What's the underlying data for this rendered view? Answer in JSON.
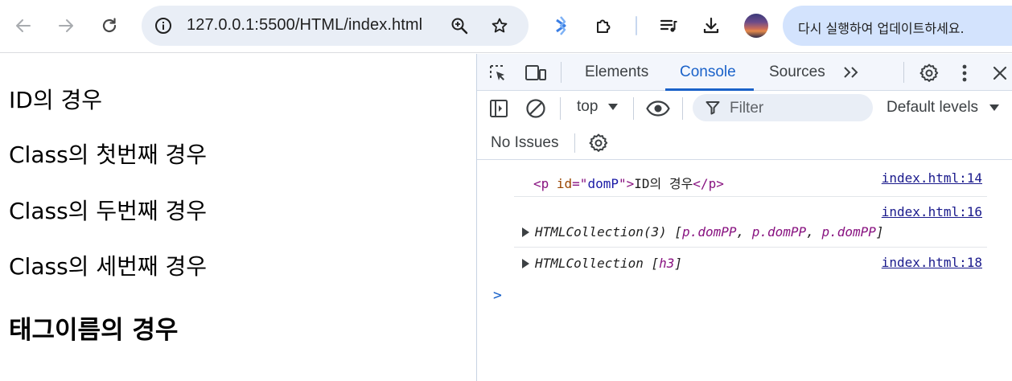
{
  "browser": {
    "url": "127.0.0.1:5500/HTML/index.html",
    "update_button_label": "다시 실행하여 업데이트하세요.",
    "icons": [
      "arrow-back-icon",
      "arrow-forward-icon",
      "reload-icon",
      "site-info-icon",
      "zoom-icon",
      "bookmark-star-icon",
      "extension-bluetooth-icon",
      "extensions-puzzle-icon",
      "media-playlist-icon",
      "download-icon",
      "profile-avatar"
    ]
  },
  "page": {
    "id_text": "ID의 경우",
    "class_first": "Class의 첫번째 경우",
    "class_second": "Class의 두번째 경우",
    "class_third": "Class의 세번째 경우",
    "tag_heading": "태그이름의 경우"
  },
  "devtools": {
    "tabs": {
      "elements": "Elements",
      "console": "Console",
      "sources": "Sources",
      "more": ">>"
    },
    "active_tab": "Console",
    "context": "top",
    "filter_placeholder": "Filter",
    "levels": "Default levels",
    "issues": "No Issues",
    "accent_color": "#1a62c9"
  },
  "console": {
    "messages": [
      {
        "source": "index.html:14",
        "open_tag": "<p",
        "attr_name": "id",
        "attr_eq": "=\"",
        "attr_value": "domP",
        "attr_close": "\">",
        "text": "ID의 경우",
        "close_tag": "</p>"
      },
      {
        "source": "index.html:16",
        "collection": "HTMLCollection(3)",
        "open_bracket": "[",
        "items": [
          "p.domPP",
          "p.domPP",
          "p.domPP"
        ],
        "separator": ", ",
        "close_bracket": "]"
      },
      {
        "source": "index.html:18",
        "collection": "HTMLCollection",
        "open_bracket": "[",
        "items": [
          "h3"
        ],
        "close_bracket": "]"
      }
    ],
    "prompt": ">"
  }
}
